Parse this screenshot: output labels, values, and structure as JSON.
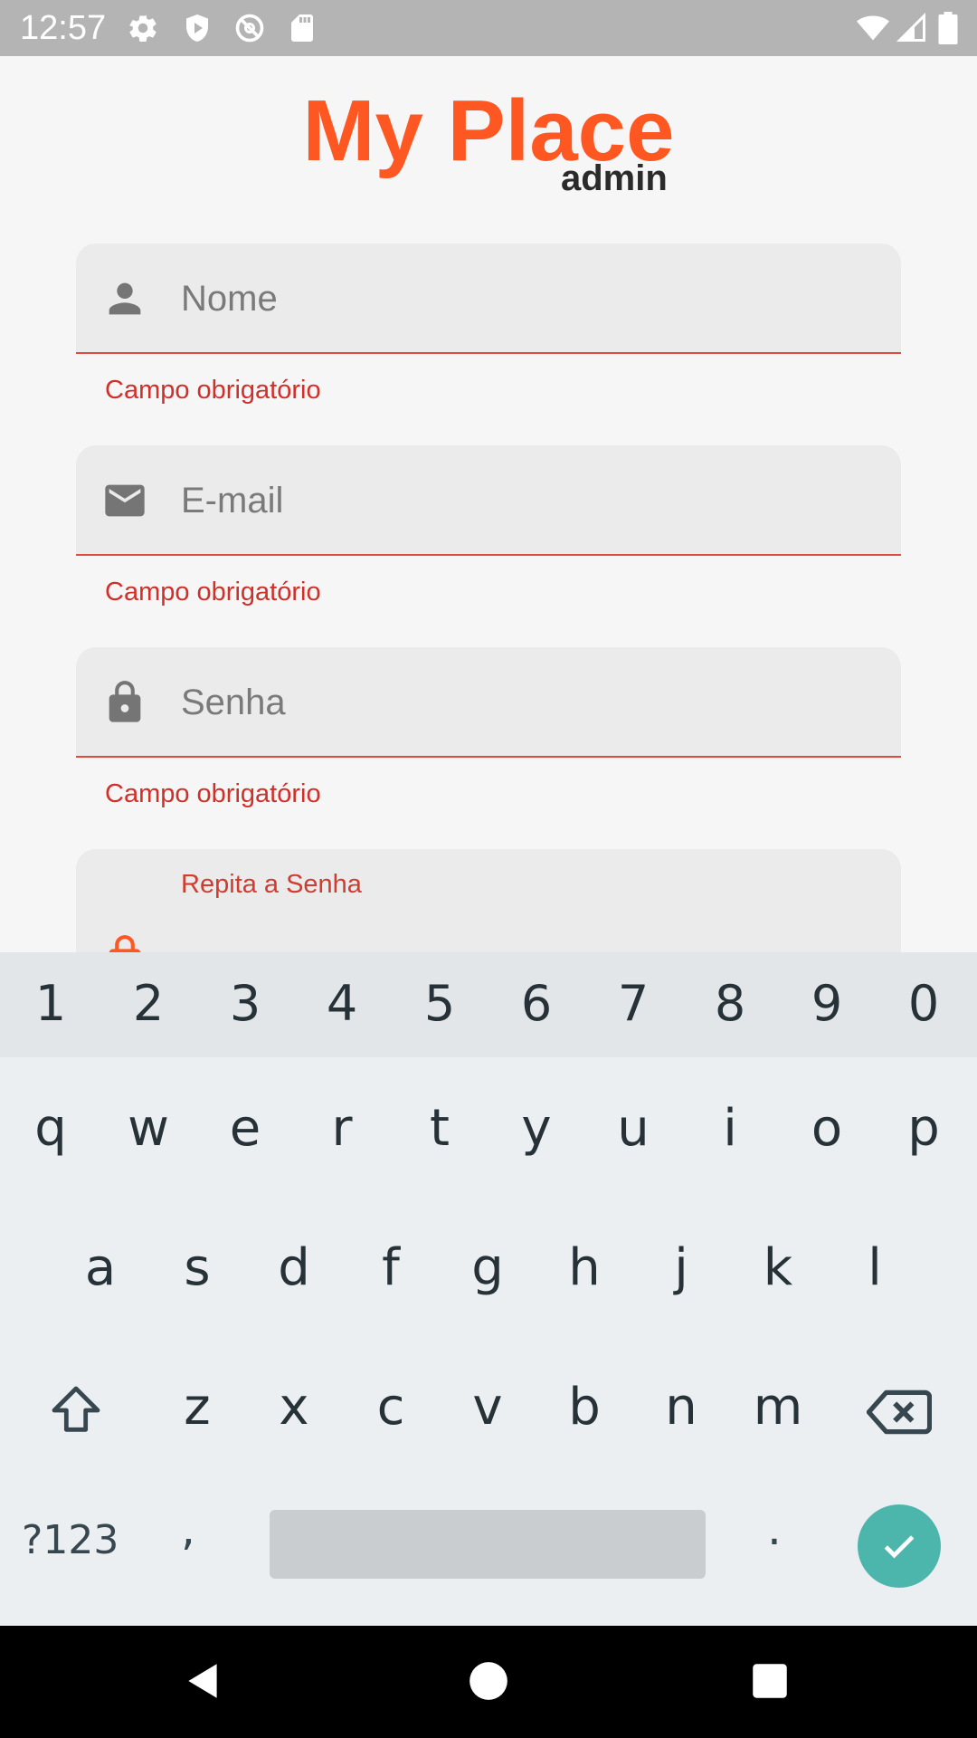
{
  "status_bar": {
    "time": "12:57",
    "icons": [
      "gear-icon",
      "shield-icon",
      "vpn-icon",
      "sd-card-icon",
      "wifi-icon",
      "signal-icon",
      "battery-icon"
    ]
  },
  "app": {
    "title": "My Place",
    "subtitle": "admin",
    "accent_color": "#ff5722",
    "error_color": "#d0302a",
    "fields": [
      {
        "icon": "person-icon",
        "placeholder": "Nome",
        "error": "Campo obrigatório"
      },
      {
        "icon": "email-icon",
        "placeholder": "E-mail",
        "error": "Campo obrigatório"
      },
      {
        "icon": "lock-icon",
        "placeholder": "Senha",
        "error": "Campo obrigatório"
      },
      {
        "icon": "lock-icon",
        "label": "Repita a Senha"
      }
    ]
  },
  "keyboard": {
    "number_row": [
      "1",
      "2",
      "3",
      "4",
      "5",
      "6",
      "7",
      "8",
      "9",
      "0"
    ],
    "row1": [
      "q",
      "w",
      "e",
      "r",
      "t",
      "y",
      "u",
      "i",
      "o",
      "p"
    ],
    "row2": [
      "a",
      "s",
      "d",
      "f",
      "g",
      "h",
      "j",
      "k",
      "l"
    ],
    "row3": [
      "z",
      "x",
      "c",
      "v",
      "b",
      "n",
      "m"
    ],
    "symbols_key": "?123",
    "comma_key": ",",
    "period_key": ".",
    "enter_color": "#4db6ac"
  },
  "nav_bar": {
    "buttons": [
      "back-icon",
      "home-icon",
      "recents-icon"
    ]
  }
}
